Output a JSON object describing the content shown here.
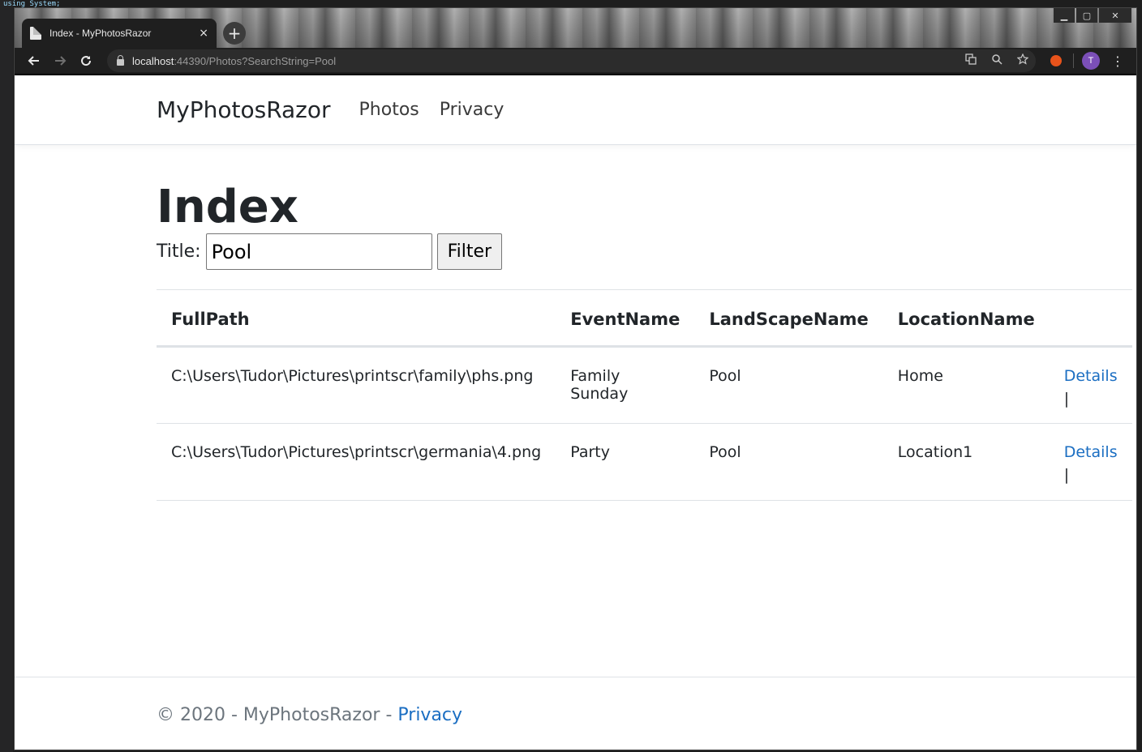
{
  "browser": {
    "tab_title": "Index - MyPhotosRazor",
    "tab_close": "×",
    "new_tab": "+",
    "url_host": "localhost",
    "url_rest": ":44390/Photos?SearchString=Pool",
    "avatar_initial": "T",
    "window_controls": {
      "minimize": "▁",
      "maximize": "▢",
      "close": "✕"
    }
  },
  "nav": {
    "brand": "MyPhotosRazor",
    "links": [
      "Photos",
      "Privacy"
    ]
  },
  "page": {
    "title": "Index",
    "filter_label": "Title:",
    "filter_value": "Pool",
    "filter_button": "Filter"
  },
  "table": {
    "headers": [
      "FullPath",
      "EventName",
      "LandScapeName",
      "LocationName"
    ],
    "rows": [
      {
        "fullpath": "C:\\Users\\Tudor\\Pictures\\printscr\\family\\phs.png",
        "event": "Family Sunday",
        "landscape": "Pool",
        "location": "Home",
        "action": "Details",
        "separator": "|"
      },
      {
        "fullpath": "C:\\Users\\Tudor\\Pictures\\printscr\\germania\\4.png",
        "event": "Party",
        "landscape": "Pool",
        "location": "Location1",
        "action": "Details",
        "separator": "|"
      }
    ]
  },
  "footer": {
    "text": "© 2020 - MyPhotosRazor - ",
    "link": "Privacy"
  },
  "background": {
    "code_keyword": "using",
    "code_text": "System;"
  },
  "icons": {
    "back": "arrow-left-icon",
    "forward": "arrow-right-icon",
    "reload": "reload-icon",
    "lock": "lock-icon",
    "translate": "translate-icon",
    "zoom": "zoom-icon",
    "star": "star-icon",
    "extension": "extension-icon",
    "menu": "menu-dots-icon"
  },
  "colors": {
    "link": "#1b6ec2",
    "avatar": "#7b4fb8"
  }
}
